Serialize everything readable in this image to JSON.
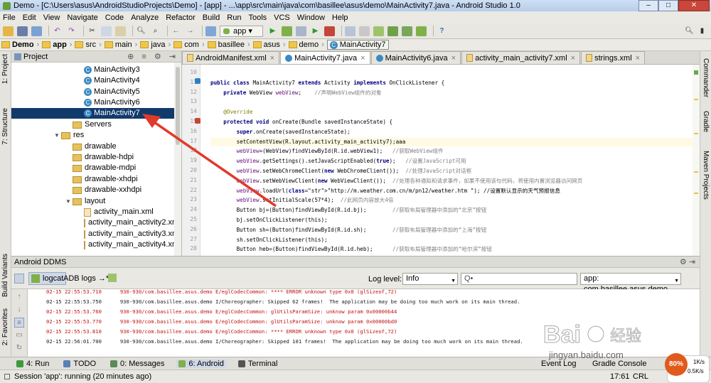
{
  "window": {
    "title": "Demo - [C:\\Users\\asus\\AndroidStudioProjects\\Demo] - [app] - ...\\app\\src\\main\\java\\com\\basillee\\asus\\demo\\MainActivity7.java - Android Studio 1.0",
    "min": "–",
    "max": "□",
    "close": "✕"
  },
  "menu": [
    "File",
    "Edit",
    "View",
    "Navigate",
    "Code",
    "Analyze",
    "Refactor",
    "Build",
    "Run",
    "Tools",
    "VCS",
    "Window",
    "Help"
  ],
  "toolbar": {
    "app_select": "app",
    "help": "?"
  },
  "breadcrumbs": [
    "Demo",
    "app",
    "src",
    "main",
    "java",
    "com",
    "basillee",
    "asus",
    "demo",
    "MainActivity7"
  ],
  "left_tabs": {
    "project": "1: Project",
    "structure": "7: Structure",
    "build_variants": "Build Variants",
    "favorites": "2: Favorites"
  },
  "right_tabs": {
    "commander": "Commander",
    "gradle": "Gradle",
    "maven": "Maven Projects"
  },
  "project_panel": {
    "title": "Project",
    "buttons": "⊕ ≡ ⚙ ⇥"
  },
  "tree": [
    {
      "type": "class",
      "label": "MainActivity3"
    },
    {
      "type": "class",
      "label": "MainActivity4"
    },
    {
      "type": "class",
      "label": "MainActivity5"
    },
    {
      "type": "class",
      "label": "MainActivity6"
    },
    {
      "type": "class",
      "label": "MainActivity7",
      "selected": true
    },
    {
      "type": "folder",
      "label": "Servers"
    },
    {
      "type": "folder",
      "label": "res",
      "open": true
    },
    {
      "type": "folder",
      "label": "drawable"
    },
    {
      "type": "folder",
      "label": "drawable-hdpi"
    },
    {
      "type": "folder",
      "label": "drawable-mdpi"
    },
    {
      "type": "folder",
      "label": "drawable-xhdpi"
    },
    {
      "type": "folder",
      "label": "drawable-xxhdpi"
    },
    {
      "type": "folder",
      "label": "layout",
      "open": true
    },
    {
      "type": "xml",
      "label": "activity_main.xml"
    },
    {
      "type": "xml",
      "label": "activity_main_activity2.xml"
    },
    {
      "type": "xml",
      "label": "activity_main_activity3.xml"
    },
    {
      "type": "xml",
      "label": "activity_main_activity4.xml"
    }
  ],
  "tabs": [
    {
      "label": "AndroidManifest.xml",
      "icon": "xml"
    },
    {
      "label": "MainActivity7.java",
      "icon": "class",
      "active": true
    },
    {
      "label": "MainActivity6.java",
      "icon": "class"
    },
    {
      "label": "activity_main_activity7.xml",
      "icon": "xml"
    },
    {
      "label": "strings.xml",
      "icon": "xml"
    }
  ],
  "code": {
    "line_numbers": [
      "10",
      "11",
      "12",
      "13",
      "14",
      "15",
      "16",
      "17",
      "18",
      "19",
      "20",
      "21",
      "22",
      "23",
      "24",
      "25",
      "26",
      "27",
      "28"
    ],
    "lines": [
      "",
      "public class MainActivity7 extends Activity implements OnClickListener {",
      "    private WebView webView;    //声明WebView组件的对象",
      "",
      "    @Override",
      "    protected void onCreate(Bundle savedInstanceState) {",
      "        super.onCreate(savedInstanceState);",
      "        setContentView(R.layout.activity_main_activity7);aaa",
      "        webView=(WebView)findViewById(R.id.webView1);   //获取WebView组件",
      "        webView.getSettings().setJavaScriptEnabled(true);   //设置JavaScript可用",
      "        webView.setWebChromeClient(new WebChromeClient());  //处理JavaScript对话框",
      "        webView.setWebViewClient(new WebViewClient());  //处理各种通知和请求事件，如果不使用该句代码，将使用内置浏览器访问网页",
      "        webView.loadUrl(\"http://m.weather.com.cn/m/pn12/weather.htm \"); //设置默认显示的天气预报信息",
      "        webView.setInitialScale(57*4);  //此网页内容放大4倍",
      "        Button bj=(Button)findViewById(R.id.bj);        //获取布局管理器中添加的“北京”按钮",
      "        bj.setOnClickListener(this);",
      "        Button sh=(Button)findViewById(R.id.sh);        //获取布局管理器中添加的“上海”按钮",
      "        sh.setOnClickListener(this);",
      "        Button heb=(Button)findViewById(R.id.heb);      //获取布局管理器中添加的“哈尔滨”按钮"
    ]
  },
  "ddms": {
    "title": "Android DDMS",
    "tabs": [
      "logcat",
      "ADB logs →*"
    ],
    "log_level_label": "Log level:",
    "log_level": "Info",
    "search_placeholder": "Q•",
    "app_filter": "app: com.basillee.asus.demo"
  },
  "logs": [
    {
      "lvl": "err",
      "text": "02-15 22:55:53.710      930-930/com.basillee.asus.demo E/eglCodecCommon: **** ERROR unknown type 0x0 (glSizeof,72)"
    },
    {
      "lvl": "inf",
      "text": "02-15 22:55:53.750      930-930/com.basillee.asus.demo I/Choreographer: Skipped 62 frames!  The application may be doing too much work on its main thread."
    },
    {
      "lvl": "err",
      "text": "02-15 22:55:53.760      930-930/com.basillee.asus.demo E/eglCodecCommon: glUtilsParamSize: unknow param 0x00000b44"
    },
    {
      "lvl": "err",
      "text": "02-15 22:55:53.770      930-930/com.basillee.asus.demo E/eglCodecCommon: glUtilsParamSize: unknow param 0x00000bd0"
    },
    {
      "lvl": "err",
      "text": "02-15 22:55:53.810      930-930/com.basillee.asus.demo E/eglCodecCommon: **** ERROR unknown type 0x0 (glSizeof,72)"
    },
    {
      "lvl": "inf",
      "text": "02-15 22:56:01.700      930-930/com.basillee.asus.demo I/Choreographer: Skipped 101 frames!  The application may be doing too much work on its main thread."
    }
  ],
  "bottom_tools": [
    {
      "label": "4: Run",
      "color": "#3c9a3c"
    },
    {
      "label": "TODO",
      "color": "#5a7fb3"
    },
    {
      "label": "0: Messages",
      "color": "#5a8a5a"
    },
    {
      "label": "6: Android",
      "color": "#7fb04a",
      "active": true
    },
    {
      "label": "Terminal",
      "color": "#555555"
    }
  ],
  "bottom_right": {
    "event_log": "Event Log",
    "gradle_console": "Gradle Console"
  },
  "status": {
    "text": "Session 'app': running (20 minutes ago)",
    "time": "17:61",
    "crlf": "CRL"
  },
  "watermark": {
    "brand": "Bai",
    "paw": "࿳",
    "suffix": "经验",
    "url": "jingyan.baidu.com"
  },
  "net": {
    "percent": "80%",
    "up": "1K/s",
    "down": "0.5K/s"
  },
  "colors": {
    "selection": "#113a6b",
    "error": "#c01212",
    "annotation_arrow": "#e03a2a"
  }
}
